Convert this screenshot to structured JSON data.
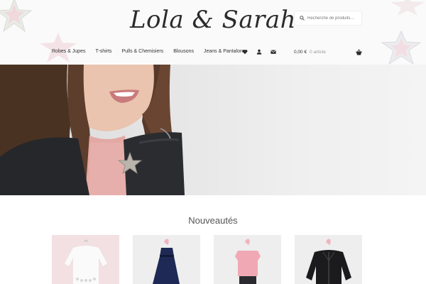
{
  "brand": {
    "logo_text": "Lola & Sarah"
  },
  "search": {
    "placeholder": "Recherche de produits…"
  },
  "nav": {
    "items": [
      {
        "label": "Robes & Jupes"
      },
      {
        "label": "T-shirts"
      },
      {
        "label": "Pulls & Chemisiers"
      },
      {
        "label": "Blousons"
      },
      {
        "label": "Jeans & Pantalons"
      }
    ]
  },
  "header_icons": [
    "heart-icon",
    "user-icon",
    "envelope-icon"
  ],
  "cart": {
    "amount": "0,00 €",
    "count": "0 article",
    "icon": "basket-icon"
  },
  "hero": {
    "image": "girl-smiling-black-leather-jacket-photo"
  },
  "section": {
    "title": "Nouveautés"
  },
  "products": [
    {
      "image": "white-sweater-with-pearls"
    },
    {
      "image": "navy-dress-on-flamingo-hanger"
    },
    {
      "image": "pink-top-on-flamingo-hanger"
    },
    {
      "image": "black-leather-jacket-on-flamingo-hanger"
    }
  ],
  "colors": {
    "header_bg": "#fafafa",
    "text": "#43454b",
    "accent_pink": "#e8a0b0"
  }
}
